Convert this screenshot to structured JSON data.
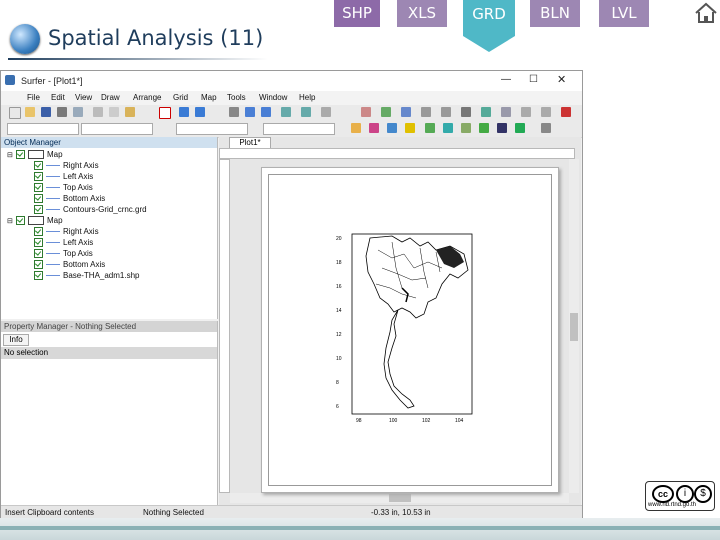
{
  "slide": {
    "title": "Spatial Analysis (11)",
    "tabs": [
      "SHP",
      "XLS",
      "GRD",
      "BLN",
      "LVL"
    ],
    "active_tab": "GRD",
    "watermark": "www.rid.rtnd.go.th",
    "colors": {
      "tab_purple": "#9d87b3",
      "tab_active": "#4fb8c7",
      "title": "#1f3d5c"
    }
  },
  "app": {
    "window_title": "Surfer - [Plot1*]",
    "menu": [
      "File",
      "Edit",
      "View",
      "Draw",
      "Arrange",
      "Grid",
      "Map",
      "Tools",
      "Window",
      "Help"
    ],
    "object_manager": {
      "title": "Object Manager",
      "tree": [
        {
          "label": "Map",
          "level": 0
        },
        {
          "label": "Right Axis",
          "level": 1
        },
        {
          "label": "Left Axis",
          "level": 1
        },
        {
          "label": "Top Axis",
          "level": 1
        },
        {
          "label": "Bottom Axis",
          "level": 1
        },
        {
          "label": "Contours-Grid_crnc.grd",
          "level": 1
        },
        {
          "label": "Map",
          "level": 0
        },
        {
          "label": "Right Axis",
          "level": 1
        },
        {
          "label": "Left Axis",
          "level": 1
        },
        {
          "label": "Top Axis",
          "level": 1
        },
        {
          "label": "Bottom Axis",
          "level": 1
        },
        {
          "label": "Base-THA_adm1.shp",
          "level": 1
        }
      ]
    },
    "property_manager": {
      "title": "Property Manager - Nothing Selected",
      "tab": "Info",
      "content": "No selection"
    },
    "plot_tab": "Plot1*",
    "status": {
      "left": "Insert Clipboard contents",
      "middle": "Nothing Selected",
      "coords": "-0.33 in, 10.53 in"
    },
    "map_axes": {
      "y_ticks": [
        "20",
        "18",
        "16",
        "14",
        "12",
        "10",
        "8",
        "6"
      ],
      "x_ticks": [
        "98",
        "100",
        "102",
        "104"
      ]
    }
  }
}
